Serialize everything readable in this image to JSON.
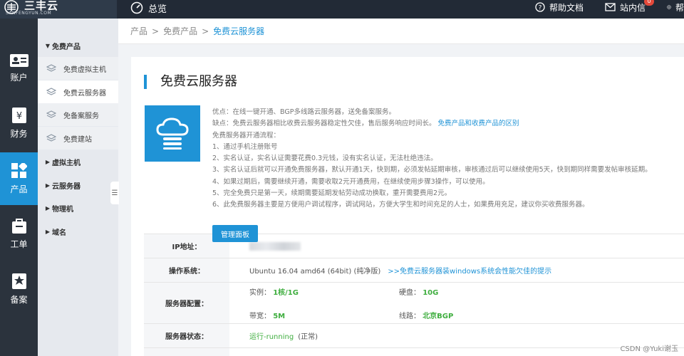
{
  "topbar": {
    "brand_name": "三丰云",
    "brand_sub": "SANFENGYUN.COM",
    "overview_label": "总览",
    "help_label": "帮助文档",
    "mail_label": "站内信",
    "mail_badge": "0",
    "more_label": "帮"
  },
  "sidebar": {
    "items": [
      {
        "label": "账户",
        "icon": "id-card-icon"
      },
      {
        "label": "财务",
        "icon": "finance-icon"
      },
      {
        "label": "产品",
        "icon": "grid-icon"
      },
      {
        "label": "工单",
        "icon": "ticket-icon"
      },
      {
        "label": "备案",
        "icon": "record-icon"
      }
    ]
  },
  "subnav": {
    "free_group": "免费产品",
    "children": [
      "免费虚拟主机",
      "免费云服务器",
      "免备案服务",
      "免费建站"
    ],
    "groups": [
      "虚拟主机",
      "云服务器",
      "物理机",
      "域名"
    ],
    "collapse": "☰"
  },
  "breadcrumb": [
    "产品",
    "免费产品",
    "免费云服务器"
  ],
  "page": {
    "title": "免费云服务器",
    "desc_lines": [
      "优点：在线一键开通、BGP多线路云服务器，送免备案服务。",
      "缺点：免费云服务器相比收费云服务器稳定性欠佳，售后服务响应时间长。",
      "免费服务器开通流程：",
      "1、通过手机注册账号",
      "2、实名认证，实名认证需要花费0.3元钱，没有实名认证，无法杜绝违法。",
      "3、实名认证后就可以开通免费服务器，默认开通1天，快到期，必须发帖延期审核，审核通过后可以继续使用5天，快到期同样需要发帖审核延期。",
      "4、如果过期后，需要继续开通，需要收取2元开通费用，在继续使用步骤3操作，可以使用。",
      "5、完全免费只是第一天，续期需要延期发帖劳动成功换取，重开需要费用2元。",
      "6、此免费服务器主要是方便用户调试程序，调试网站，方便大学生和时间充足的人士，如果费用充足，建议你买收费服务器。"
    ],
    "diff_link": "免费产品和收费产品的区别",
    "panel_button": "管理面板"
  },
  "server": {
    "ip_label": "IP地址：",
    "os_label": "操作系统：",
    "os_value": "Ubuntu 16.04 amd64 (64bit) (纯净版)",
    "os_tip": ">>免费云服务器装windows系统会性能欠佳的提示",
    "config_label": "服务器配置：",
    "cpu_label": "实例：",
    "cpu_value": "1核/1G",
    "disk_label": "硬盘：",
    "disk_value": "10G",
    "bw_label": "带宽：",
    "bw_value": "5M",
    "line_label": "线路：",
    "line_value": "北京BGP",
    "status_label": "服务器状态：",
    "status_value": "运行-running",
    "status_note": "(正常)"
  },
  "watermark": "CSDN @Yuki谢玉",
  "colors": {
    "accent": "#1f93d6",
    "sidebar_bg": "#2b333d",
    "topbar_bg": "#222a36",
    "ok_green": "#3fae3f"
  }
}
